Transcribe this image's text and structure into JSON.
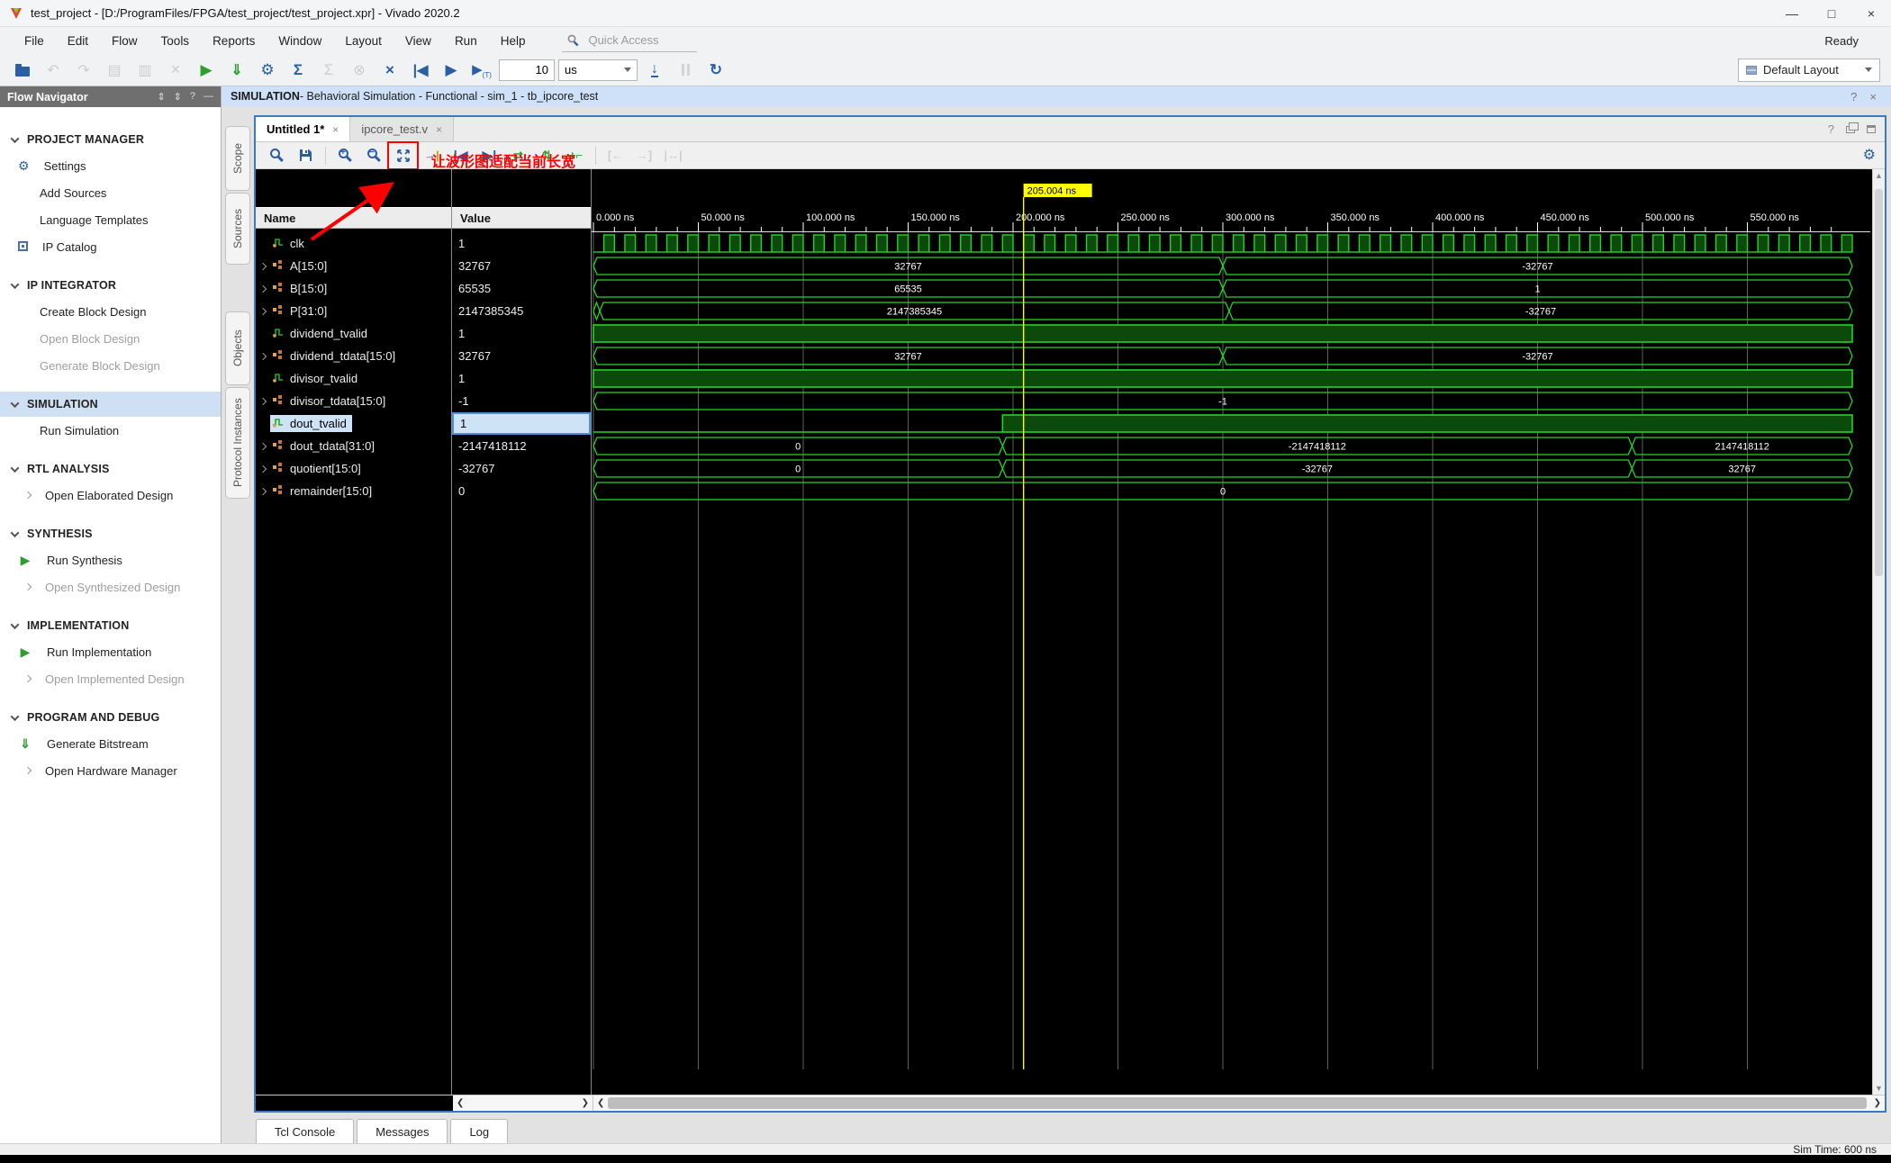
{
  "window": {
    "title": "test_project - [D:/ProgramFiles/FPGA/test_project/test_project.xpr] - Vivado 2020.2",
    "status_ready": "Ready",
    "controls": [
      "minimize",
      "maximize",
      "close"
    ]
  },
  "menu": {
    "items": [
      "File",
      "Edit",
      "Flow",
      "Tools",
      "Reports",
      "Window",
      "Layout",
      "View",
      "Run",
      "Help"
    ],
    "quick_access_placeholder": "Quick Access"
  },
  "toolbar": {
    "icons_left": [
      {
        "name": "open-project-icon"
      },
      {
        "name": "undo-icon",
        "disabled": true
      },
      {
        "name": "redo-icon",
        "disabled": true
      },
      {
        "name": "copy-icon",
        "disabled": true
      },
      {
        "name": "paste-icon",
        "disabled": true
      },
      {
        "name": "delete-icon",
        "disabled": true
      },
      {
        "name": "run-flow-icon"
      },
      {
        "name": "generate-bitstream-icon"
      },
      {
        "name": "settings-gear-icon"
      },
      {
        "name": "report-sigma-icon"
      },
      {
        "name": "validate-icon",
        "disabled": true
      },
      {
        "name": "link-icon",
        "disabled": true
      },
      {
        "name": "relaunch-icon"
      },
      {
        "name": "restart-sim-icon"
      },
      {
        "name": "run-all-icon"
      },
      {
        "name": "run-for-time-icon"
      }
    ],
    "icons_right": [
      {
        "name": "step-icon"
      },
      {
        "name": "pause-icon",
        "disabled": true
      },
      {
        "name": "relaunch-sim-icon"
      }
    ],
    "run_time_value": "10",
    "run_time_unit": "us",
    "layout_selector": "Default Layout"
  },
  "flow_navigator": {
    "title": "Flow Navigator",
    "sections": [
      {
        "label": "PROJECT MANAGER",
        "items": [
          {
            "label": "Settings",
            "icon": "gear"
          },
          {
            "label": "Add Sources"
          },
          {
            "label": "Language Templates"
          },
          {
            "label": "IP Catalog",
            "icon": "ip"
          }
        ]
      },
      {
        "label": "IP INTEGRATOR",
        "items": [
          {
            "label": "Create Block Design"
          },
          {
            "label": "Open Block Design",
            "disabled": true
          },
          {
            "label": "Generate Block Design",
            "disabled": true
          }
        ]
      },
      {
        "label": "SIMULATION",
        "selected": true,
        "items": [
          {
            "label": "Run Simulation"
          }
        ]
      },
      {
        "label": "RTL ANALYSIS",
        "items": [
          {
            "label": "Open Elaborated Design",
            "chevron": true
          }
        ]
      },
      {
        "label": "SYNTHESIS",
        "items": [
          {
            "label": "Run Synthesis",
            "icon": "play"
          },
          {
            "label": "Open Synthesized Design",
            "disabled": true,
            "chevron": true
          }
        ]
      },
      {
        "label": "IMPLEMENTATION",
        "items": [
          {
            "label": "Run Implementation",
            "icon": "play"
          },
          {
            "label": "Open Implemented Design",
            "disabled": true,
            "chevron": true
          }
        ]
      },
      {
        "label": "PROGRAM AND DEBUG",
        "items": [
          {
            "label": "Generate Bitstream",
            "icon": "bitstream"
          },
          {
            "label": "Open Hardware Manager",
            "chevron": true
          }
        ]
      }
    ]
  },
  "sim_header": {
    "title": "SIMULATION",
    "subtitle": " - Behavioral Simulation - Functional - sim_1 - tb_ipcore_test"
  },
  "side_tabs": [
    "Scope",
    "Sources",
    "Objects",
    "Protocol Instances"
  ],
  "wave_tabs": [
    {
      "label": "Untitled 1*",
      "active": true
    },
    {
      "label": "ipcore_test.v",
      "active": false
    }
  ],
  "wave_toolbar": {
    "icons": [
      {
        "name": "search-icon"
      },
      {
        "name": "save-icon"
      },
      {
        "sep": true
      },
      {
        "name": "zoom-in-icon"
      },
      {
        "name": "zoom-out-icon"
      },
      {
        "name": "zoom-fit-icon",
        "boxed": true
      },
      {
        "name": "goto-cursor-icon"
      },
      {
        "name": "prev-transition-icon"
      },
      {
        "name": "next-transition-icon"
      },
      {
        "name": "swap-icon"
      },
      {
        "name": "sort-icon"
      },
      {
        "name": "add-group-icon"
      },
      {
        "sep": true
      },
      {
        "name": "prev-marker-icon",
        "disabled": true
      },
      {
        "name": "next-marker-icon",
        "disabled": true
      },
      {
        "name": "span-markers-icon",
        "disabled": true
      }
    ]
  },
  "annotation": {
    "text": "让波形图适配当前长宽",
    "color": "#ff0000"
  },
  "wave_table": {
    "name_header": "Name",
    "value_header": "Value",
    "signals": [
      {
        "name": "clk",
        "value": "1",
        "expandable": false,
        "selected": false,
        "icon": "bit",
        "wave": {
          "type": "clock",
          "period_ns": 10
        }
      },
      {
        "name": "A[15:0]",
        "value": "32767",
        "expandable": true,
        "icon": "bus",
        "wave": {
          "type": "bus",
          "segments": [
            {
              "t0": 0,
              "t1": 300,
              "label": "32767"
            },
            {
              "t0": 300,
              "t1": 600,
              "label": "-32767"
            }
          ]
        }
      },
      {
        "name": "B[15:0]",
        "value": "65535",
        "expandable": true,
        "icon": "bus",
        "wave": {
          "type": "bus",
          "segments": [
            {
              "t0": 0,
              "t1": 300,
              "label": "65535"
            },
            {
              "t0": 300,
              "t1": 600,
              "label": "1"
            }
          ]
        }
      },
      {
        "name": "P[31:0]",
        "value": "2147385345",
        "expandable": true,
        "icon": "bus",
        "wave": {
          "type": "bus",
          "segments": [
            {
              "t0": 0,
              "t1": 3,
              "label": ""
            },
            {
              "t0": 3,
              "t1": 303,
              "label": "2147385345"
            },
            {
              "t0": 303,
              "t1": 600,
              "label": "-32767"
            }
          ]
        }
      },
      {
        "name": "dividend_tvalid",
        "value": "1",
        "expandable": false,
        "icon": "bit",
        "wave": {
          "type": "bit",
          "segments": [
            {
              "t0": 0,
              "t1": 600,
              "v": 1
            }
          ]
        }
      },
      {
        "name": "dividend_tdata[15:0]",
        "value": "32767",
        "expandable": true,
        "icon": "bus",
        "wave": {
          "type": "bus",
          "segments": [
            {
              "t0": 0,
              "t1": 300,
              "label": "32767"
            },
            {
              "t0": 300,
              "t1": 600,
              "label": "-32767"
            }
          ]
        }
      },
      {
        "name": "divisor_tvalid",
        "value": "1",
        "expandable": false,
        "icon": "bit",
        "wave": {
          "type": "bit",
          "segments": [
            {
              "t0": 0,
              "t1": 600,
              "v": 1
            }
          ]
        }
      },
      {
        "name": "divisor_tdata[15:0]",
        "value": "-1",
        "expandable": true,
        "icon": "bus",
        "wave": {
          "type": "bus",
          "segments": [
            {
              "t0": 0,
              "t1": 600,
              "label": "-1"
            }
          ]
        }
      },
      {
        "name": "dout_tvalid",
        "value": "1",
        "expandable": false,
        "selected": true,
        "icon": "bit",
        "wave": {
          "type": "bit",
          "segments": [
            {
              "t0": 0,
              "t1": 195,
              "v": 0
            },
            {
              "t0": 195,
              "t1": 600,
              "v": 1
            }
          ]
        }
      },
      {
        "name": "dout_tdata[31:0]",
        "value": "-2147418112",
        "expandable": true,
        "icon": "bus",
        "wave": {
          "type": "bus",
          "segments": [
            {
              "t0": 0,
              "t1": 195,
              "label": "0"
            },
            {
              "t0": 195,
              "t1": 495,
              "label": "-2147418112"
            },
            {
              "t0": 495,
              "t1": 600,
              "label": "2147418112"
            }
          ]
        }
      },
      {
        "name": "quotient[15:0]",
        "value": "-32767",
        "expandable": true,
        "icon": "bus",
        "wave": {
          "type": "bus",
          "segments": [
            {
              "t0": 0,
              "t1": 195,
              "label": "0"
            },
            {
              "t0": 195,
              "t1": 495,
              "label": "-32767"
            },
            {
              "t0": 495,
              "t1": 600,
              "label": "32767"
            }
          ]
        }
      },
      {
        "name": "remainder[15:0]",
        "value": "0",
        "expandable": true,
        "icon": "bus",
        "wave": {
          "type": "bus",
          "segments": [
            {
              "t0": 0,
              "t1": 600,
              "label": "0"
            }
          ]
        }
      }
    ]
  },
  "waveform": {
    "time_start_ns": 0,
    "time_end_ns": 600,
    "cursor_ns": 205.004,
    "cursor_label": "205.004 ns",
    "label_interval_ns": 50,
    "minor_tick_ns": 10,
    "ruler_labels": [
      "0.000 ns",
      "50.000 ns",
      "100.000 ns",
      "150.000 ns",
      "200.000 ns",
      "250.000 ns",
      "300.000 ns",
      "350.000 ns",
      "400.000 ns",
      "450.000 ns",
      "500.000 ns",
      "550.000 ns"
    ],
    "colors": {
      "wave": "#23d523",
      "wave_fill": "#0b4a0b",
      "cursor": "#ffff00",
      "grid": "#5f5f5f",
      "label": "#ffffff"
    }
  },
  "bottom_tabs": [
    "Tcl Console",
    "Messages",
    "Log"
  ],
  "status_bar": {
    "sim_time": "Sim Time: 600 ns"
  }
}
